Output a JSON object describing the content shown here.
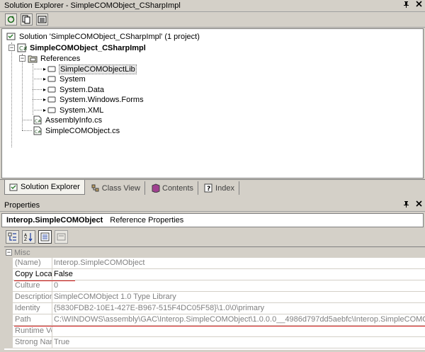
{
  "solution_explorer": {
    "title": "Solution Explorer - SimpleCOMObject_CSharpImpl",
    "pin_glyph": "▕",
    "close_glyph": "×",
    "tree": {
      "solution": "Solution 'SimpleCOMObject_CSharpImpl' (1 project)",
      "project": "SimpleCOMObject_CSharpImpl",
      "references": "References",
      "refs": [
        "SimpleCOMObjectLib",
        "System",
        "System.Data",
        "System.Windows.Forms",
        "System.XML"
      ],
      "files": [
        "AssemblyInfo.cs",
        "SimpleCOMObject.cs"
      ]
    },
    "tabs": [
      {
        "label": "Solution Explorer"
      },
      {
        "label": "Class View"
      },
      {
        "label": "Contents"
      },
      {
        "label": "Index"
      }
    ]
  },
  "properties": {
    "title": "Properties",
    "object_name": "Interop.SimpleCOMObject",
    "object_type": "Reference Properties",
    "category": "Misc",
    "rows": [
      {
        "key": "(Name)",
        "value": "Interop.SimpleCOMObject"
      },
      {
        "key": "Copy Local",
        "value": "False"
      },
      {
        "key": "Culture",
        "value": "0"
      },
      {
        "key": "Description",
        "value": "SimpleCOMObject 1.0 Type Library"
      },
      {
        "key": "Identity",
        "value": "{5830FDB2-10E1-427E-B967-515F4DC05F58}\\1.0\\0\\primary"
      },
      {
        "key": "Path",
        "value": "C:\\WINDOWS\\assembly\\GAC\\Interop.SimpleCOMObject\\1.0.0.0__4986d797dd5aebfc\\Interop.SimpleCOMObject.dll"
      },
      {
        "key": "Runtime Version",
        "value": ""
      },
      {
        "key": "Strong Name",
        "value": "True"
      }
    ]
  },
  "colors": {
    "chrome": "#d4d0c8",
    "underline": "#d01818"
  }
}
